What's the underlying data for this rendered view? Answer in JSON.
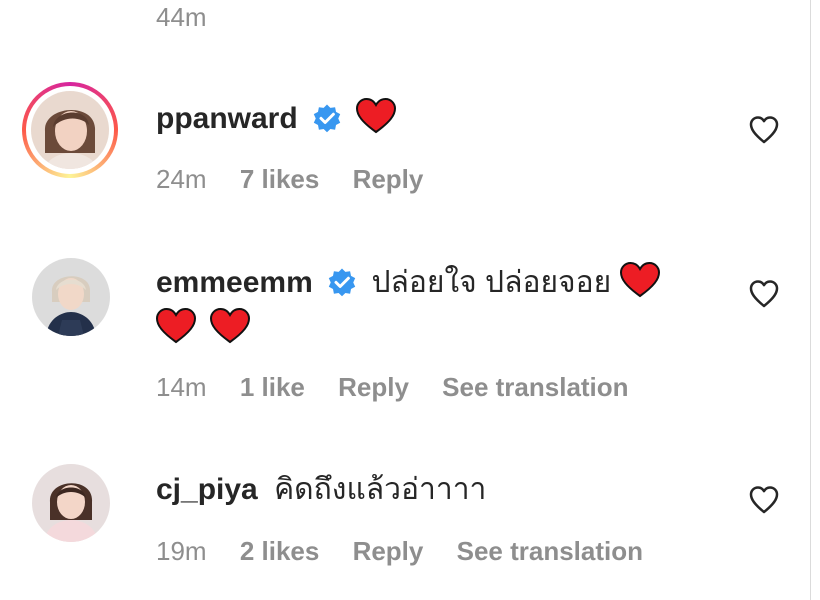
{
  "previous": {
    "time": "44m"
  },
  "comments": [
    {
      "username": "ppanward",
      "verified": true,
      "text": "",
      "hearts_line1": 1,
      "time": "24m",
      "likes": "7 likes",
      "reply": "Reply",
      "translate": ""
    },
    {
      "username": "emmeemm",
      "verified": true,
      "text": "ปล่อยใจ ปล่อยจอย",
      "time": "14m",
      "likes": "1 like",
      "reply": "Reply",
      "translate": "See translation"
    },
    {
      "username": "cj_piya",
      "verified": false,
      "text": "คิดถึงแล้วอ่าาาา",
      "time": "19m",
      "likes": "2 likes",
      "reply": "Reply",
      "translate": "See translation"
    }
  ],
  "colors": {
    "verified": "#3897f0",
    "heart": "#ed1d24",
    "muted": "#8e8e8e",
    "text": "#262626"
  }
}
